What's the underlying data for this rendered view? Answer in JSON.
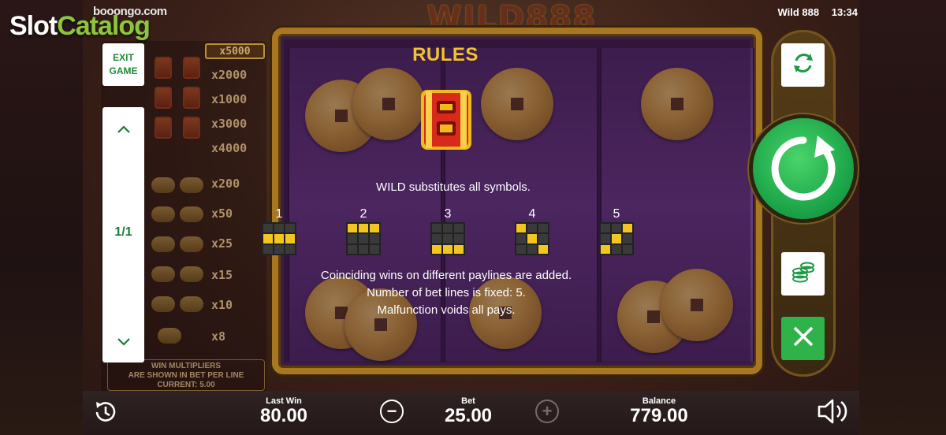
{
  "brand": {
    "slot": "Slot",
    "catalog": "Catalog",
    "provider": "booongo.com"
  },
  "header": {
    "game_name": "Wild 888",
    "time": "13:34",
    "logo_text": "WILD888"
  },
  "controls": {
    "exit_label_1": "EXIT",
    "exit_label_2": "GAME",
    "scroll_up_icon": "chevron-up-icon",
    "scroll_down_icon": "chevron-down-icon",
    "page_indicator": "1/1",
    "autoplay_icon": "repeat-icon",
    "spin_icon": "spin-arrow-icon",
    "bet_icon": "coins-stack-icon",
    "close_icon": "close-icon",
    "spin_color": "#2fb24a"
  },
  "paytable": {
    "top_multiplier": "x5000",
    "rows": [
      "x2000",
      "x1000",
      "x3000",
      "x4000",
      "x200",
      "x50",
      "x25",
      "x15",
      "x10",
      "x8"
    ],
    "note_line1": "WIN MULTIPLIERS",
    "note_line2": "ARE SHOWN IN BET PER LINE",
    "note_line3": "CURRENT: 5.00"
  },
  "rules": {
    "title": "RULES",
    "wild_text": "WILD substitutes all symbols.",
    "paylines": [
      {
        "number": "1",
        "cells": [
          0,
          0,
          0,
          1,
          1,
          1,
          0,
          0,
          0
        ]
      },
      {
        "number": "2",
        "cells": [
          1,
          1,
          1,
          0,
          0,
          0,
          0,
          0,
          0
        ]
      },
      {
        "number": "3",
        "cells": [
          0,
          0,
          0,
          0,
          0,
          0,
          1,
          1,
          1
        ]
      },
      {
        "number": "4",
        "cells": [
          1,
          0,
          0,
          0,
          1,
          0,
          0,
          0,
          1
        ]
      },
      {
        "number": "5",
        "cells": [
          0,
          0,
          1,
          0,
          1,
          0,
          1,
          0,
          0
        ]
      }
    ],
    "line1": "Coinciding wins on different paylines are added.",
    "line2": "Number of bet lines is fixed: 5.",
    "line3": "Malfunction voids all pays.",
    "accent_color": "#f2c230"
  },
  "bottom": {
    "history_icon": "history-clock-icon",
    "last_win_label": "Last Win",
    "last_win_value": "80.00",
    "bet_label": "Bet",
    "bet_value": "25.00",
    "minus_symbol": "−",
    "plus_symbol": "+",
    "balance_label": "Balance",
    "balance_value": "779.00",
    "sound_icon": "speaker-icon"
  }
}
